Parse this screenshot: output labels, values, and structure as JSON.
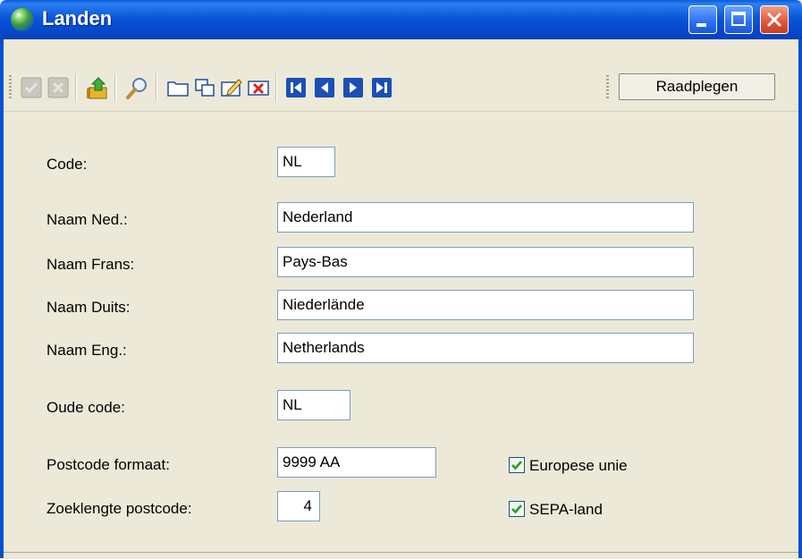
{
  "window": {
    "title": "Landen"
  },
  "toolbar": {
    "icons": [
      "check-icon",
      "cancel-icon",
      "export-icon",
      "search-icon",
      "folder-icon",
      "copy-icon",
      "edit-icon",
      "delete-icon",
      "first-record-icon",
      "previous-record-icon",
      "next-record-icon",
      "last-record-icon"
    ],
    "mode_label": "Raadplegen"
  },
  "form": {
    "code": {
      "label": "Code:",
      "value": "NL"
    },
    "naam_ned": {
      "label": "Naam Ned.:",
      "value": "Nederland"
    },
    "naam_frans": {
      "label": "Naam Frans:",
      "value": "Pays-Bas"
    },
    "naam_duits": {
      "label": "Naam Duits:",
      "value": "Niederlände"
    },
    "naam_eng": {
      "label": "Naam Eng.:",
      "value": "Netherlands"
    },
    "oude_code": {
      "label": "Oude code:",
      "value": "NL"
    },
    "postcode_formaat": {
      "label": "Postcode formaat:",
      "value": "9999 AA"
    },
    "zoeklengte_postcode": {
      "label": "Zoeklengte postcode:",
      "value": "4"
    },
    "europese_unie": {
      "label": "Europese unie",
      "checked": true
    },
    "sepa_land": {
      "label": "SEPA-land",
      "checked": true
    }
  },
  "colors": {
    "titlebar": "#0a55d8",
    "window_bg": "#ece9d8",
    "field_border": "#7f9db9"
  }
}
